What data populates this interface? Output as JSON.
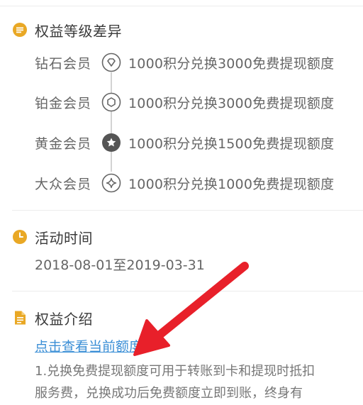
{
  "benefit_levels": {
    "title": "权益等级差异",
    "tiers": [
      {
        "name": "钻石会员",
        "desc": "1000积分兑换3000免费提现额度",
        "icon": "diamond-icon"
      },
      {
        "name": "铂金会员",
        "desc": "1000积分兑换3000免费提现额度",
        "icon": "hexagon-icon"
      },
      {
        "name": "黄金会员",
        "desc": "1000积分兑换1500免费提现额度",
        "icon": "star-icon"
      },
      {
        "name": "大众会员",
        "desc": "1000积分兑换1000免费提现额度",
        "icon": "sparkle-icon"
      }
    ]
  },
  "activity_time": {
    "title": "活动时间",
    "dates": "2018-08-01至2019-03-31"
  },
  "benefit_intro": {
    "title": "权益介绍",
    "link": "点击查看当前额度",
    "line1": "1.兑换免费提现额度可用于转账到卡和提现时抵扣",
    "line2": "服务费，兑换成功后免费额度立即到账，终身有"
  },
  "colors": {
    "accent": "#e9a825",
    "link": "#3b8fd6",
    "arrow": "#e8202a"
  }
}
